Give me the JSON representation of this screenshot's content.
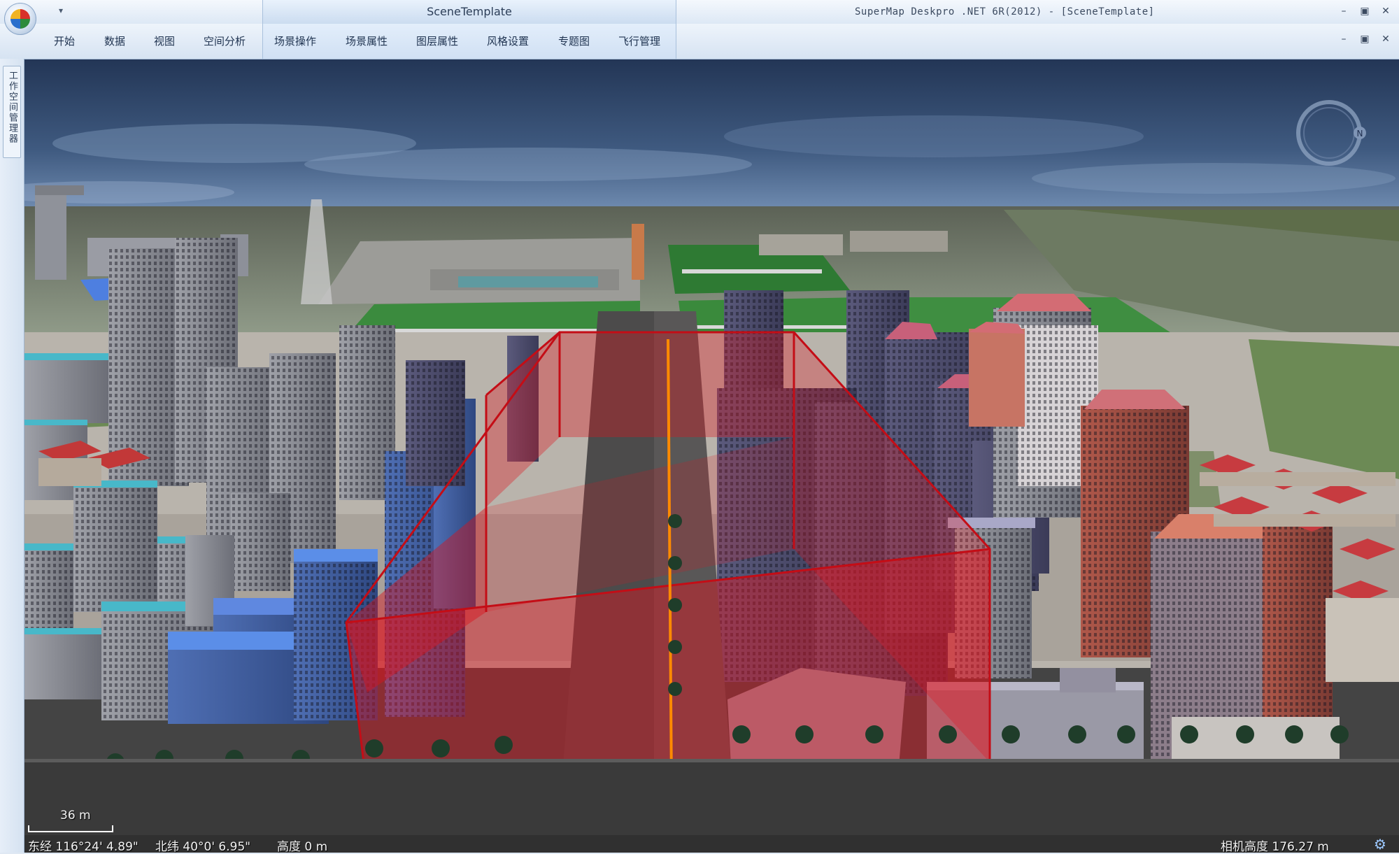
{
  "window": {
    "doc_title": "SceneTemplate",
    "app_title": "SuperMap Deskpro .NET 6R(2012) - [SceneTemplate]",
    "qat_dropdown": "▾",
    "minimize": "–",
    "restore": "▣",
    "close": "✕",
    "doc_minimize": "–",
    "doc_restore": "▣",
    "doc_close": "✕"
  },
  "ribbon": {
    "tabs": [
      "开始",
      "数据",
      "视图",
      "空间分析",
      "场景操作",
      "场景属性",
      "图层属性",
      "风格设置",
      "专题图",
      "飞行管理"
    ]
  },
  "sidebar": {
    "workspace_tab": "工作空间管理器"
  },
  "scene": {
    "compass_letter": "N",
    "scale_label": "36 m"
  },
  "status": {
    "longitude": "东经 116°24' 4.89\"",
    "latitude": "北纬 40°0' 6.95\"",
    "altitude": "高度 0 m",
    "camera_altitude": "相机高度 176.27 m"
  },
  "colors": {
    "highlight_box": "#e0141e",
    "centerline": "#ff8a00",
    "sky_top": "#273a5c",
    "sky_bottom": "#5d789c",
    "ground": "#3a3a3a"
  },
  "icons": {
    "app_menu": "supermap-logo-icon",
    "settings": "gear-icon"
  }
}
